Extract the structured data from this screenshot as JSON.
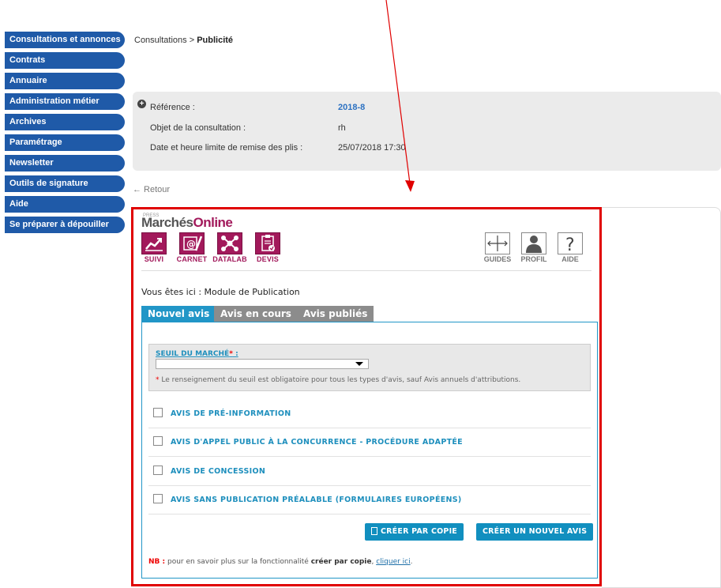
{
  "sidebar": {
    "items": [
      {
        "label": "Consultations et annonces"
      },
      {
        "label": "Contrats"
      },
      {
        "label": "Annuaire"
      },
      {
        "label": "Administration métier"
      },
      {
        "label": "Archives"
      },
      {
        "label": "Paramétrage"
      },
      {
        "label": "Newsletter"
      },
      {
        "label": "Outils de signature"
      },
      {
        "label": "Aide"
      },
      {
        "label": "Se préparer à dépouiller"
      }
    ]
  },
  "breadcrumb": {
    "parent": "Consultations",
    "separator": " > ",
    "current": "Publicité"
  },
  "consultation": {
    "reference_label": "Référence :",
    "reference_value": "2018-8",
    "objet_label": "Objet de la consultation :",
    "objet_value": "rh",
    "date_label": "Date et heure limite de remise des plis :",
    "date_value": "25/07/2018 17:30"
  },
  "retour_label": "← Retour",
  "module": {
    "logo_small": "PRESS",
    "logo_main": "Marchés",
    "logo_accent": "Online",
    "apps": [
      {
        "label": "SUIVI",
        "icon": "chart-trend-icon"
      },
      {
        "label": "CARNET",
        "icon": "at-contact-icon"
      },
      {
        "label": "DATALAB",
        "icon": "network-icon"
      },
      {
        "label": "DEVIS",
        "icon": "clipboard-check-icon"
      }
    ],
    "tools": [
      {
        "label": "GUIDES",
        "icon": "arrows-cross-icon"
      },
      {
        "label": "PROFIL",
        "icon": "user-icon"
      },
      {
        "label": "AIDE",
        "icon": "question-icon"
      }
    ],
    "you_are_here": "Vous êtes ici : Module de Publication",
    "tabs": [
      {
        "label": "Nouvel avis",
        "active": true
      },
      {
        "label": "Avis en cours",
        "active": false
      },
      {
        "label": "Avis publiés",
        "active": false
      }
    ],
    "seuil": {
      "label": "SEUIL DU MARCHÉ",
      "required_star": "*",
      "colon": " :",
      "selected": "",
      "note_star": "*",
      "note": " Le renseignement du seuil est obligatoire pour tous les types d'avis, sauf Avis annuels d'attributions."
    },
    "avis_types": [
      {
        "label": "AVIS DE PRÉ-INFORMATION",
        "checked": false
      },
      {
        "label": "AVIS D'APPEL PUBLIC À LA CONCURRENCE - PROCÉDURE ADAPTÉE",
        "checked": false
      },
      {
        "label": "AVIS DE CONCESSION",
        "checked": false
      },
      {
        "label": "AVIS SANS PUBLICATION PRÉALABLE (FORMULAIRES EUROPÉENS)",
        "checked": false
      }
    ],
    "buttons": {
      "copy": "CRÉER PAR COPIE",
      "new": "CRÉER UN NOUVEL AVIS"
    },
    "nb": {
      "label": "NB :",
      "text_before": " pour en savoir plus sur la fonctionnalité ",
      "bold": "créer par copie",
      "text_mid": ", ",
      "link": "cliquer ici",
      "text_after": "."
    }
  },
  "colors": {
    "sidebar_bg": "#1f5aa8",
    "brand": "#a2195b",
    "tab_active": "#2196c7",
    "tab_inactive": "#8c8c8c",
    "button": "#118fbf",
    "annotation": "#e00000"
  }
}
